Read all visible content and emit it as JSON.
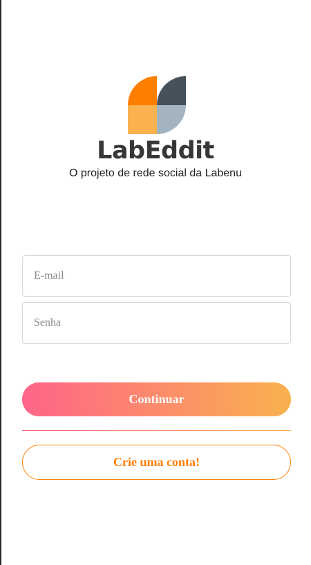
{
  "brand": {
    "logo_icon": "labeddit-logo-icon",
    "title": "LabEddit",
    "subtitle": "O projeto de rede social da Labenu",
    "logo_colors": {
      "orange": "#fe7e02",
      "light_orange": "#f9b24e",
      "dark_slate": "#45525b",
      "light_slate": "#a3b4c0"
    }
  },
  "form": {
    "email_placeholder": "E-mail",
    "email_value": "",
    "password_placeholder": "Senha",
    "password_value": ""
  },
  "actions": {
    "continue_label": "Continuar",
    "signup_label": "Crie uma conta!"
  },
  "colors": {
    "gradient_start": "#ff6489",
    "gradient_end": "#f9b24e",
    "accent": "#fe7e02",
    "input_border": "#d5d8de"
  }
}
